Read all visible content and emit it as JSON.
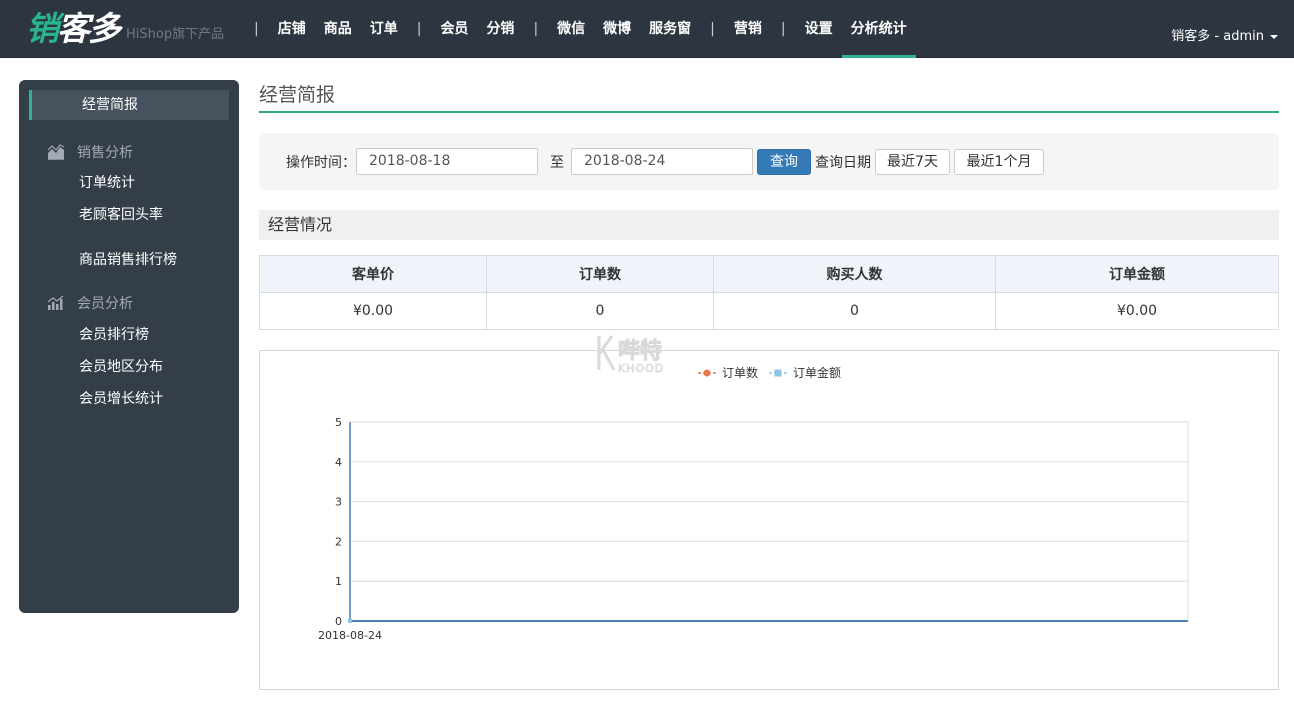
{
  "header": {
    "logo_part1": "销",
    "logo_part2": "客多",
    "logo_sub": "HiShop旗下产品",
    "nav": [
      {
        "type": "sep",
        "label": "|"
      },
      {
        "type": "item",
        "label": "店铺"
      },
      {
        "type": "item",
        "label": "商品"
      },
      {
        "type": "item",
        "label": "订单"
      },
      {
        "type": "sep",
        "label": "|"
      },
      {
        "type": "item",
        "label": "会员"
      },
      {
        "type": "item",
        "label": "分销"
      },
      {
        "type": "sep",
        "label": "|"
      },
      {
        "type": "item",
        "label": "微信"
      },
      {
        "type": "item",
        "label": "微博"
      },
      {
        "type": "item",
        "label": "服务窗"
      },
      {
        "type": "sep",
        "label": "|"
      },
      {
        "type": "item",
        "label": "营销"
      },
      {
        "type": "sep",
        "label": "|"
      },
      {
        "type": "item",
        "label": "设置"
      },
      {
        "type": "item",
        "label": "分析统计",
        "active": true
      }
    ],
    "user": "销客多 - admin"
  },
  "sidebar": {
    "active": "经营简报",
    "group1": {
      "label": "销售分析",
      "icon": "area-chart-icon"
    },
    "group1_items": [
      "订单统计",
      "老顾客回头率",
      "商品销售排行榜"
    ],
    "group2": {
      "label": "会员分析",
      "icon": "bar-chart-icon"
    },
    "group2_items": [
      "会员排行榜",
      "会员地区分布",
      "会员增长统计"
    ]
  },
  "main": {
    "title": "经营简报",
    "filter": {
      "label": "操作时间：",
      "start_date": "2018-08-18",
      "to": "至",
      "end_date": "2018-08-24",
      "query_button": "查询",
      "query_date_label": "查询日期",
      "last7": "最近7天",
      "last1m": "最近1个月"
    },
    "section": "经营情况",
    "table": {
      "headers": [
        "客单价",
        "订单数",
        "购买人数",
        "订单金额"
      ],
      "row": [
        "¥0.00",
        "0",
        "0",
        "¥0.00"
      ]
    },
    "watermark": "K 哔特 KHOOD"
  },
  "colors": {
    "accent": "#2fb595",
    "nav_bg": "#2c3540",
    "sidebar_bg": "#333e48",
    "primary": "#337ab7",
    "series_orders": "#e8794f",
    "series_amount": "#8ec6ea"
  },
  "chart_data": {
    "type": "line",
    "title": "",
    "xlabel": "",
    "ylabel": "",
    "x": [
      "2018-08-24"
    ],
    "series": [
      {
        "name": "订单数",
        "values": [
          0
        ],
        "color": "#e8794f",
        "marker": "circle"
      },
      {
        "name": "订单金额",
        "values": [
          0
        ],
        "color": "#8ec6ea",
        "marker": "square"
      }
    ],
    "ylim": [
      0,
      5
    ],
    "yticks": [
      0,
      1,
      2,
      3,
      4,
      5
    ],
    "grid": true,
    "legend": "top-center"
  }
}
